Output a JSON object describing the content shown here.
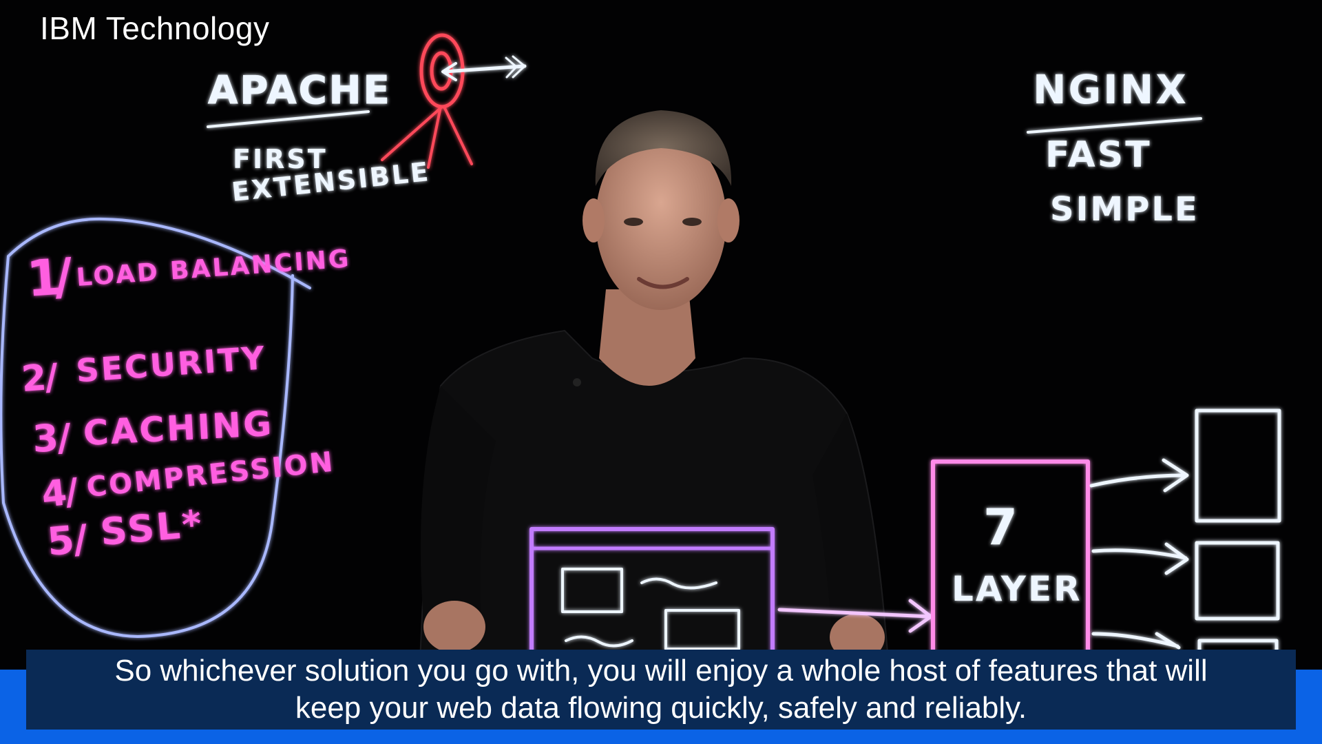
{
  "brand": {
    "label": "IBM Technology"
  },
  "board": {
    "apache": {
      "title": "APACHE",
      "traits": [
        "FIRST",
        "EXTENSIBLE"
      ]
    },
    "nginx": {
      "title": "NGINX",
      "traits": [
        "FAST",
        "SIMPLE"
      ]
    },
    "features": [
      {
        "number": "1",
        "label": "LOAD BALANCING"
      },
      {
        "number": "2",
        "label": "SECURITY"
      },
      {
        "number": "3",
        "label": "CACHING"
      },
      {
        "number": "4",
        "label": "COMPRESSION"
      },
      {
        "number": "5",
        "label": "SSL*"
      }
    ],
    "layer": {
      "number": "7",
      "label": "LAYER"
    }
  },
  "caption": {
    "line1": "So whichever solution you go with, you will enjoy a whole host of features that will",
    "line2": "keep your web data flowing quickly, safely and reliably."
  },
  "colors": {
    "background": "#020203",
    "chalk_white": "#eef6ff",
    "chalk_pink": "#ff5ee0",
    "chalk_red": "#ff4a5a",
    "chalk_purple": "#c27bff",
    "chalk_blue_ring": "#a9b8ff",
    "caption_box": "#0a2a55",
    "caption_bar": "#0b63e6"
  }
}
